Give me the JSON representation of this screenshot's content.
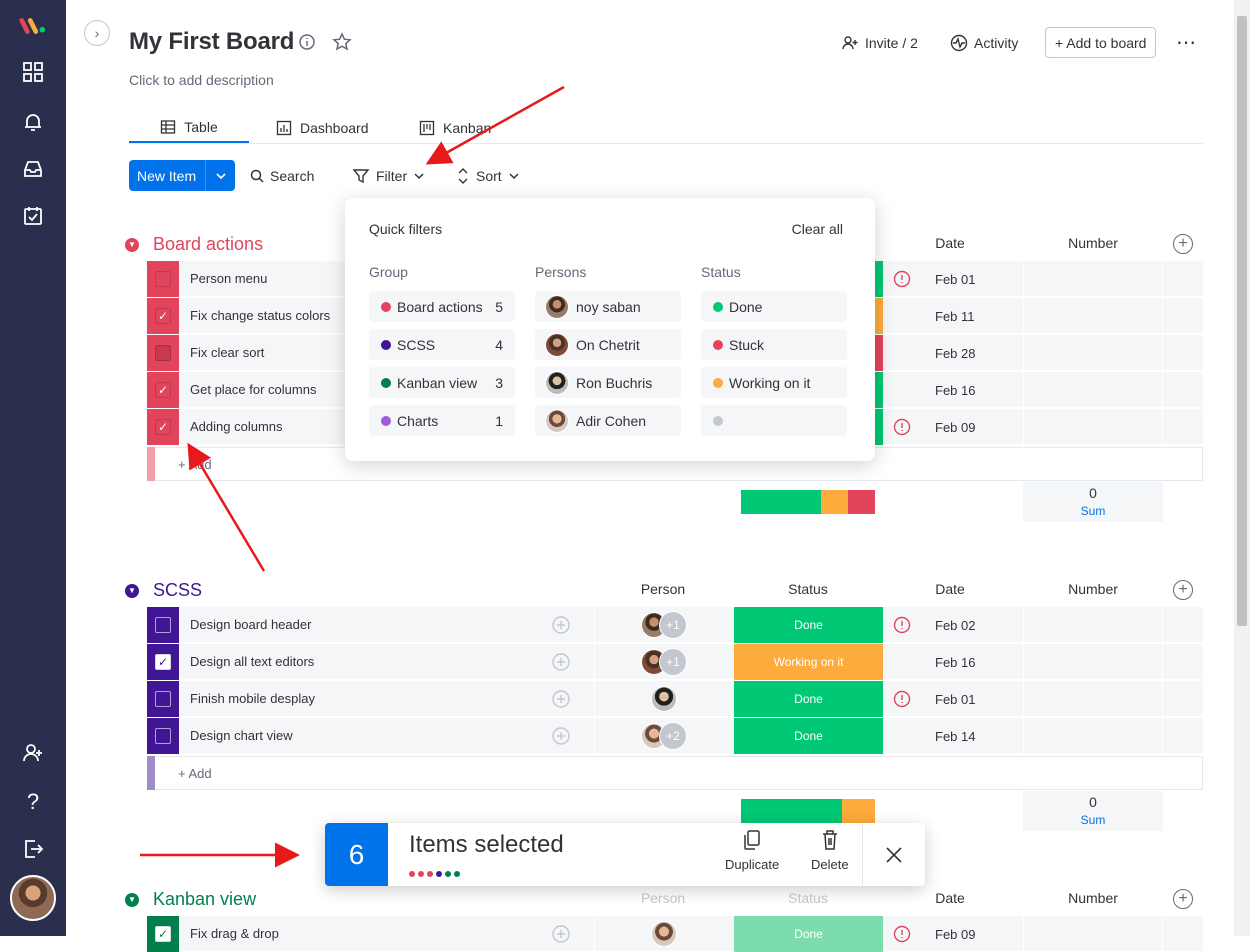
{
  "sidebar": {
    "icons": [
      "logo-icon",
      "grid-icon",
      "bell-icon",
      "inbox-icon",
      "calendar-check-icon",
      "add-user-icon",
      "help-icon",
      "logout-icon"
    ]
  },
  "header": {
    "title": "My First Board",
    "description": "Click to add description",
    "invite": "Invite / 2",
    "activity": "Activity",
    "add_to_board": "+ Add to board"
  },
  "tabs": [
    {
      "label": "Table"
    },
    {
      "label": "Dashboard"
    },
    {
      "label": "Kanban"
    }
  ],
  "toolbar": {
    "new_item": "New Item",
    "search": "Search",
    "filter": "Filter",
    "sort": "Sort"
  },
  "columns": {
    "person": "Person",
    "status": "Status",
    "date": "Date",
    "number": "Number"
  },
  "colors": {
    "done": "#00c875",
    "working": "#fdab3d",
    "stuck": "#e2445c",
    "board_actions": "#e2445c",
    "scss": "#401694",
    "kanban": "#037f4c",
    "charts": "#a25ddc",
    "accent": "#0073ea"
  },
  "groups": {
    "board_actions": {
      "title": "Board actions",
      "rows": [
        {
          "name": "Person menu",
          "date": "Feb 01"
        },
        {
          "name": "Fix change status colors",
          "date": "Feb 11"
        },
        {
          "name": "Fix clear sort",
          "date": "Feb 28"
        },
        {
          "name": "Get place for columns",
          "date": "Feb 16"
        },
        {
          "name": "Adding columns",
          "date": "Feb 09"
        }
      ],
      "add": "+ Add",
      "sum_value": "0",
      "sum_label": "Sum"
    },
    "scss": {
      "title": "SCSS",
      "rows": [
        {
          "name": "Design board header",
          "status": "Done",
          "date": "Feb 02",
          "extra": "+1"
        },
        {
          "name": "Design all text editors",
          "status": "Working on it",
          "date": "Feb 16",
          "extra": "+1"
        },
        {
          "name": "Finish mobile desplay",
          "status": "Done",
          "date": "Feb 01"
        },
        {
          "name": "Design chart view",
          "status": "Done",
          "date": "Feb 14",
          "extra": "+2"
        }
      ],
      "add": "+ Add",
      "sum_value": "0",
      "sum_label": "Sum"
    },
    "kanban": {
      "title": "Kanban view",
      "rows": [
        {
          "name": "Fix drag & drop",
          "status": "Done",
          "date": "Feb 09"
        }
      ]
    }
  },
  "quick_filters": {
    "title": "Quick filters",
    "clear_all": "Clear all",
    "group_header": "Group",
    "persons_header": "Persons",
    "status_header": "Status",
    "groups": [
      {
        "label": "Board actions",
        "count": "5"
      },
      {
        "label": "SCSS",
        "count": "4"
      },
      {
        "label": "Kanban view",
        "count": "3"
      },
      {
        "label": "Charts",
        "count": "1"
      }
    ],
    "persons": [
      {
        "label": "noy saban"
      },
      {
        "label": "On Chetrit"
      },
      {
        "label": "Ron Buchris"
      },
      {
        "label": "Adir Cohen"
      }
    ],
    "statuses": [
      {
        "label": "Done"
      },
      {
        "label": "Stuck"
      },
      {
        "label": "Working on it"
      },
      {
        "label": ""
      }
    ]
  },
  "selection": {
    "count": "6",
    "text": "Items selected",
    "duplicate": "Duplicate",
    "delete": "Delete"
  }
}
